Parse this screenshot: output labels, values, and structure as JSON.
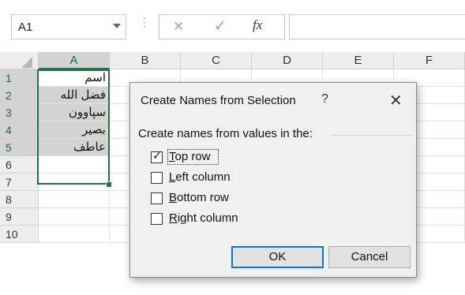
{
  "formula_bar": {
    "name_box_value": "A1",
    "cancel_symbol": "×",
    "enter_symbol": "✓",
    "fx_label": "fx",
    "formula_value": ""
  },
  "grid": {
    "columns": [
      "A",
      "B",
      "C",
      "D",
      "E",
      "F"
    ],
    "rows": [
      "1",
      "2",
      "3",
      "4",
      "5",
      "6",
      "7",
      "8",
      "9",
      "10"
    ],
    "column_a_values": [
      "اسم",
      "فضل الله",
      "سپاوون",
      "بصير",
      "عاطف"
    ]
  },
  "dialog": {
    "title": "Create Names from Selection",
    "help": "?",
    "close": "✕",
    "group_label": "Create names from values in the:",
    "options": [
      {
        "accel": "T",
        "rest": "op row",
        "checked": true
      },
      {
        "accel": "L",
        "rest": "eft column",
        "checked": false
      },
      {
        "accel": "B",
        "rest": "ottom row",
        "checked": false
      },
      {
        "accel": "R",
        "rest": "ight column",
        "checked": false
      }
    ],
    "check_glyph": "✓",
    "ok_label": "OK",
    "cancel_label": "Cancel"
  },
  "colors": {
    "selection_green": "#217346",
    "dialog_bg": "#f0f0f0",
    "default_button_border": "#0078d7"
  }
}
